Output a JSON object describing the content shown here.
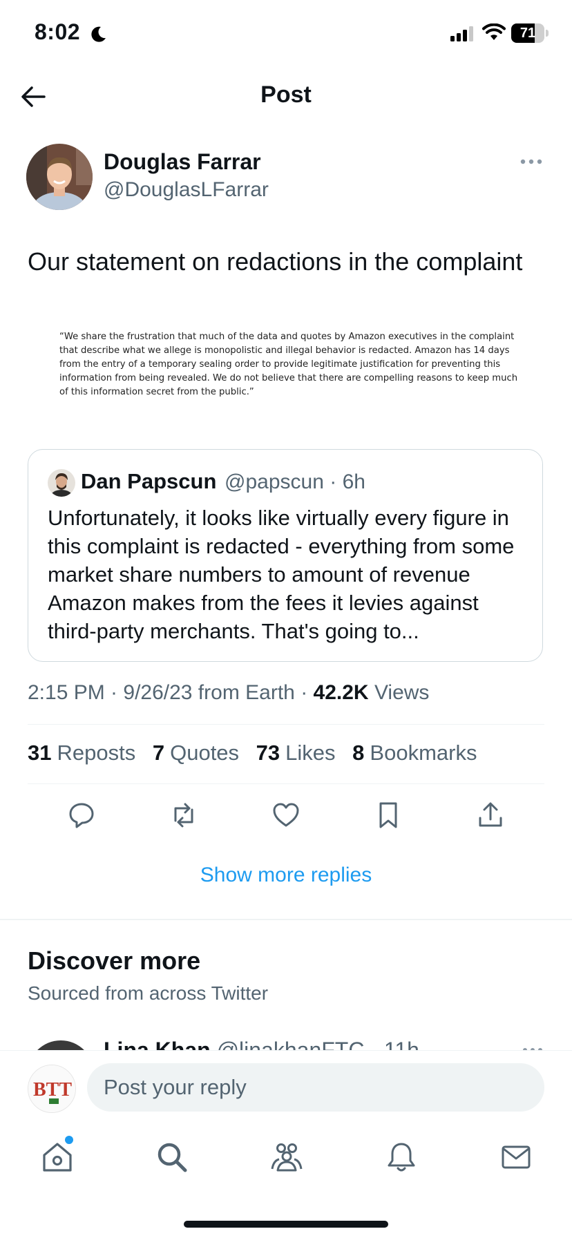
{
  "status_bar": {
    "time": "8:02",
    "battery": "71",
    "battery_level": 0.71
  },
  "header": {
    "title": "Post"
  },
  "post": {
    "author_name": "Douglas Farrar",
    "author_handle": "@DouglasLFarrar",
    "text": "Our statement on redactions in the complaint",
    "image_text": "“We share the frustration that much of the data and quotes by Amazon executives in the complaint that describe what we allege is monopolistic and illegal behavior is redacted. Amazon has 14 days from the entry of a temporary sealing order to provide legitimate justification for preventing this information from being revealed. We do not believe that there are compelling reasons to keep much of this information secret from the public.”",
    "quoted": {
      "name": "Dan Papscun",
      "handle": "@papscun",
      "time": "6h",
      "text": "Unfortunately, it looks like virtually every figure in this complaint is redacted - everything from some market share numbers to amount of revenue Amazon makes from the fees it levies against third-party merchants. That's going to..."
    },
    "timestamp": "2:15 PM · 9/26/23 from Earth",
    "views_count": "42.2K",
    "views_label": "Views",
    "stats": [
      {
        "count": "31",
        "label": "Reposts"
      },
      {
        "count": "7",
        "label": "Quotes"
      },
      {
        "count": "73",
        "label": "Likes"
      },
      {
        "count": "8",
        "label": "Bookmarks"
      }
    ]
  },
  "show_more_replies": "Show more replies",
  "discover": {
    "title": "Discover more",
    "subtitle": "Sourced from across Twitter",
    "peek_name": "Lina Khan",
    "peek_meta": "@linakhanFTC · 11h"
  },
  "reply": {
    "placeholder": "Post your reply",
    "avatar_text": "BTT"
  },
  "icons": {
    "back": "arrow-left-icon",
    "more": "more-horizontal-icon",
    "reply": "reply-icon",
    "repost": "repost-icon",
    "like": "heart-icon",
    "bookmark": "bookmark-icon",
    "share": "share-icon",
    "tabs": [
      "home-icon",
      "search-icon",
      "communities-icon",
      "notifications-icon",
      "messages-icon"
    ]
  },
  "colors": {
    "accent": "#1d9bf0",
    "text": "#0f1419",
    "secondary": "#536471",
    "border": "#cfd9de"
  }
}
